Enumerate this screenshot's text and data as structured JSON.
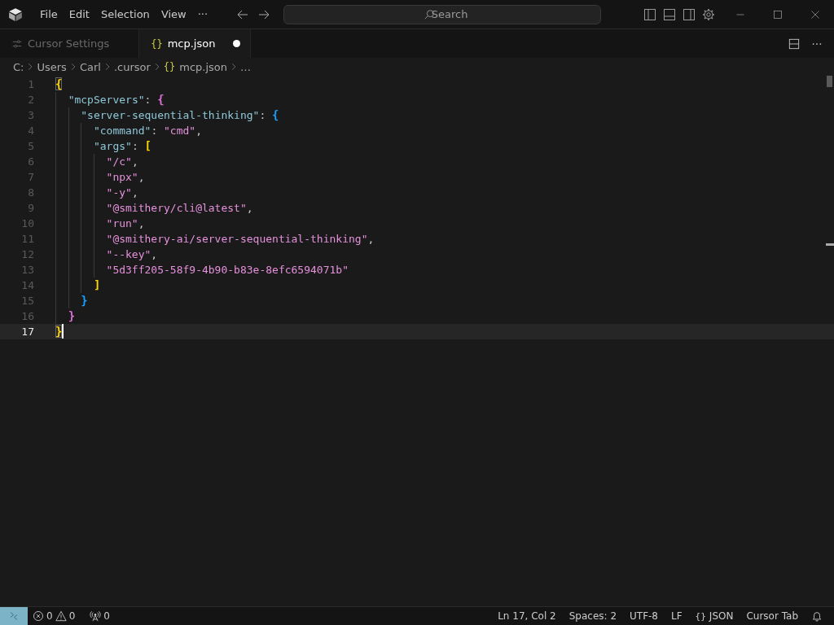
{
  "title_bar": {
    "menu": [
      {
        "label": "File"
      },
      {
        "label": "Edit"
      },
      {
        "label": "Selection"
      },
      {
        "label": "View"
      },
      {
        "label": "···"
      }
    ],
    "search": {
      "placeholder": "Search"
    }
  },
  "tabs": [
    {
      "label": "Cursor Settings",
      "kind": "settings",
      "selected": false,
      "dirty": false
    },
    {
      "label": "mcp.json",
      "kind": "json",
      "icon": "{}",
      "selected": true,
      "dirty": true
    }
  ],
  "breadcrumb": [
    {
      "label": "C:"
    },
    {
      "label": "Users"
    },
    {
      "label": "Carl"
    },
    {
      "label": ".cursor"
    },
    {
      "label": "mcp.json",
      "icon": "{}"
    },
    {
      "label": "…"
    }
  ],
  "editor": {
    "lines": [
      {
        "number": "1",
        "current": false,
        "tokens": [
          {
            "kind": "bracket",
            "text": "{",
            "color": "#ffd700",
            "matched": true
          }
        ]
      },
      {
        "number": "2",
        "current": false,
        "tokens": [
          {
            "kind": "key",
            "text": "  \"mcpServers\""
          },
          {
            "kind": "punct",
            "text": ": "
          },
          {
            "kind": "bracket",
            "text": "{",
            "color": "#da70d6",
            "matched": false
          }
        ]
      },
      {
        "number": "3",
        "current": false,
        "tokens": [
          {
            "kind": "key",
            "text": "    \"server-sequential-thinking\""
          },
          {
            "kind": "punct",
            "text": ": "
          },
          {
            "kind": "bracket",
            "text": "{",
            "color": "#179fff",
            "matched": false
          }
        ]
      },
      {
        "number": "4",
        "current": false,
        "tokens": [
          {
            "kind": "key",
            "text": "      \"command\""
          },
          {
            "kind": "punct",
            "text": ": "
          },
          {
            "kind": "string",
            "text": "\"cmd\""
          },
          {
            "kind": "punct",
            "text": ","
          }
        ]
      },
      {
        "number": "5",
        "current": false,
        "tokens": [
          {
            "kind": "key",
            "text": "      \"args\""
          },
          {
            "kind": "punct",
            "text": ": "
          },
          {
            "kind": "bracket",
            "text": "[",
            "color": "#ffd700",
            "matched": false
          }
        ]
      },
      {
        "number": "6",
        "current": false,
        "tokens": [
          {
            "kind": "string",
            "text": "        \"/c\""
          },
          {
            "kind": "punct",
            "text": ","
          }
        ]
      },
      {
        "number": "7",
        "current": false,
        "tokens": [
          {
            "kind": "string",
            "text": "        \"npx\""
          },
          {
            "kind": "punct",
            "text": ","
          }
        ]
      },
      {
        "number": "8",
        "current": false,
        "tokens": [
          {
            "kind": "string",
            "text": "        \"-y\""
          },
          {
            "kind": "punct",
            "text": ","
          }
        ]
      },
      {
        "number": "9",
        "current": false,
        "tokens": [
          {
            "kind": "string",
            "text": "        \"@smithery/cli@latest\""
          },
          {
            "kind": "punct",
            "text": ","
          }
        ]
      },
      {
        "number": "10",
        "current": false,
        "tokens": [
          {
            "kind": "string",
            "text": "        \"run\""
          },
          {
            "kind": "punct",
            "text": ","
          }
        ]
      },
      {
        "number": "11",
        "current": false,
        "tokens": [
          {
            "kind": "string",
            "text": "        \"@smithery-ai/server-sequential-thinking\""
          },
          {
            "kind": "punct",
            "text": ","
          }
        ]
      },
      {
        "number": "12",
        "current": false,
        "tokens": [
          {
            "kind": "string",
            "text": "        \"--key\""
          },
          {
            "kind": "punct",
            "text": ","
          }
        ]
      },
      {
        "number": "13",
        "current": false,
        "tokens": [
          {
            "kind": "string",
            "text": "        \"5d3ff205-58f9-4b90-b83e-8efc6594071b\""
          }
        ]
      },
      {
        "number": "14",
        "current": false,
        "tokens": [
          {
            "kind": "bracket",
            "text": "      ]",
            "color": "#ffd700",
            "matched": false
          }
        ]
      },
      {
        "number": "15",
        "current": false,
        "tokens": [
          {
            "kind": "bracket",
            "text": "    }",
            "color": "#179fff",
            "matched": false
          }
        ]
      },
      {
        "number": "16",
        "current": false,
        "tokens": [
          {
            "kind": "bracket",
            "text": "  }",
            "color": "#da70d6",
            "matched": false
          }
        ]
      },
      {
        "number": "17",
        "current": true,
        "tokens": [
          {
            "kind": "bracket",
            "text": "}",
            "color": "#ffd700",
            "matched": true
          }
        ]
      }
    ]
  },
  "status_bar": {
    "errors": "0",
    "warnings": "0",
    "ports": "0",
    "items": [
      {
        "label": "Ln 17, Col 2"
      },
      {
        "label": "Spaces: 2"
      },
      {
        "label": "UTF-8"
      },
      {
        "label": "LF"
      },
      {
        "label": "JSON",
        "icon": "{}"
      },
      {
        "label": "Cursor Tab"
      }
    ]
  }
}
